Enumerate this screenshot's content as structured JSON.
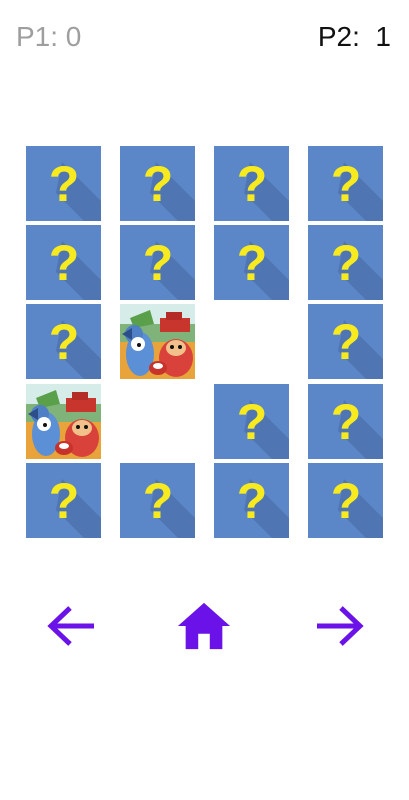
{
  "scoreboard": {
    "player1": "P1: 0",
    "player2": "P2:  1"
  },
  "board": {
    "rows": 5,
    "columns": 4,
    "hidden_symbol": "?",
    "cells": [
      [
        "hidden",
        "hidden",
        "hidden",
        "hidden"
      ],
      [
        "hidden",
        "hidden",
        "hidden",
        "hidden"
      ],
      [
        "hidden",
        "revealed",
        "removed",
        "hidden"
      ],
      [
        "revealed",
        "removed",
        "hidden",
        "hidden"
      ],
      [
        "hidden",
        "hidden",
        "hidden",
        "hidden"
      ]
    ]
  },
  "navigation": {
    "back_icon": "arrow-left-icon",
    "home_icon": "home-icon",
    "forward_icon": "arrow-right-icon"
  },
  "colors": {
    "card_back": "#5b86c7",
    "card_shadow": "#4f76b2",
    "question_mark": "#f7ea1e",
    "nav_accent": "#6a12e8",
    "player1_score": "#9e9e9e",
    "player2_score": "#111111"
  }
}
